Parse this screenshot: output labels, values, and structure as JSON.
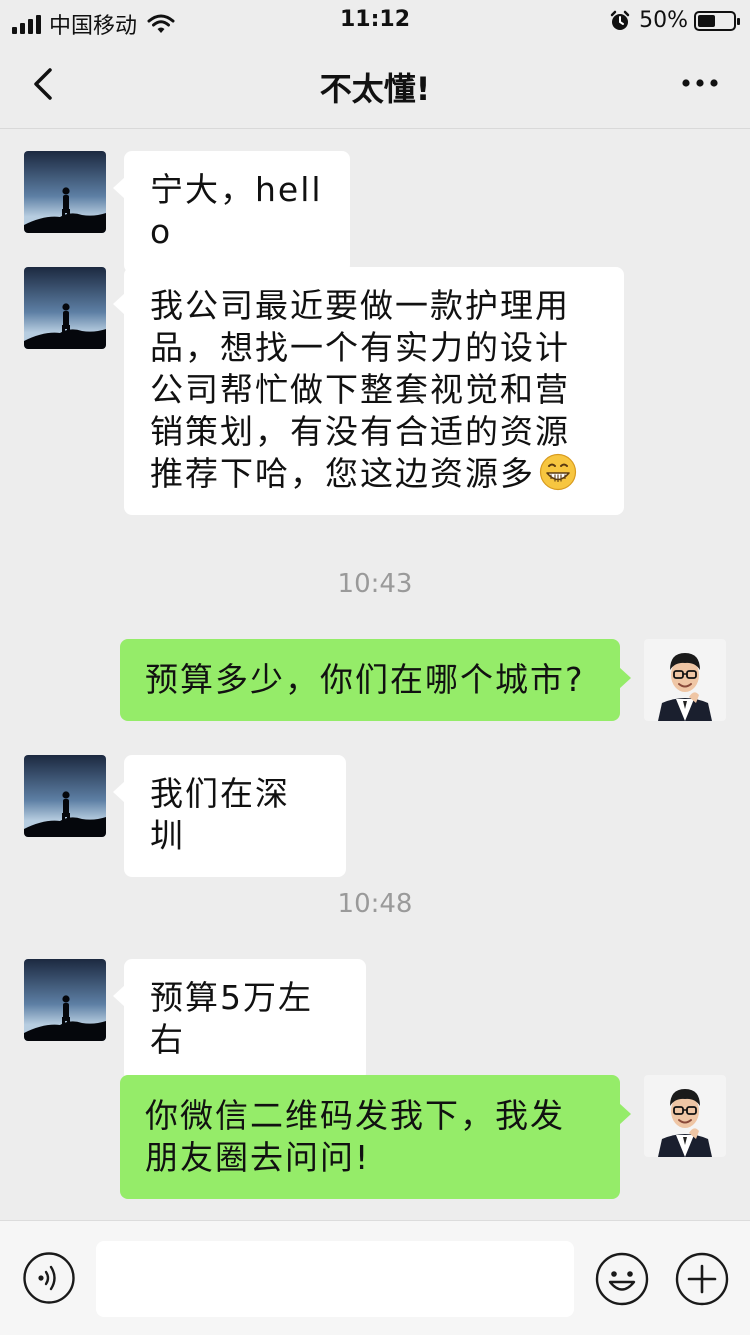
{
  "status_bar": {
    "carrier": "中国移动",
    "time": "11:12",
    "battery_percent": "50%",
    "battery_level": 0.5,
    "icons": [
      "signal-icon",
      "wifi-icon",
      "alarm-icon",
      "battery-icon"
    ]
  },
  "nav": {
    "title": "不太懂!",
    "back_icon": "chevron-left-icon",
    "more_icon": "more-dots-icon"
  },
  "messages": [
    {
      "type": "incoming",
      "text": "宁大，hello"
    },
    {
      "type": "incoming",
      "text": "我公司最近要做一款护理用品，想找一个有实力的设计公司帮忙做下整套视觉和营销策划，有没有合适的资源推荐下哈，您这边资源多",
      "emoji": "grinning-face-emoji"
    },
    {
      "type": "timestamp",
      "text": "10:43"
    },
    {
      "type": "outgoing",
      "text": "预算多少，你们在哪个城市?"
    },
    {
      "type": "incoming",
      "text": "我们在深圳"
    },
    {
      "type": "timestamp",
      "text": "10:48"
    },
    {
      "type": "incoming",
      "text": "预算5万左右"
    },
    {
      "type": "outgoing",
      "text": "你微信二维码发我下，我发朋友圈去问问!"
    }
  ],
  "input_bar": {
    "message_value": "",
    "icons": [
      "voice-icon",
      "emoji-icon",
      "plus-icon"
    ]
  },
  "colors": {
    "background": "#ededed",
    "incoming_bubble": "#ffffff",
    "outgoing_bubble": "#95ec69",
    "timestamp_text": "#9a9a9a"
  }
}
